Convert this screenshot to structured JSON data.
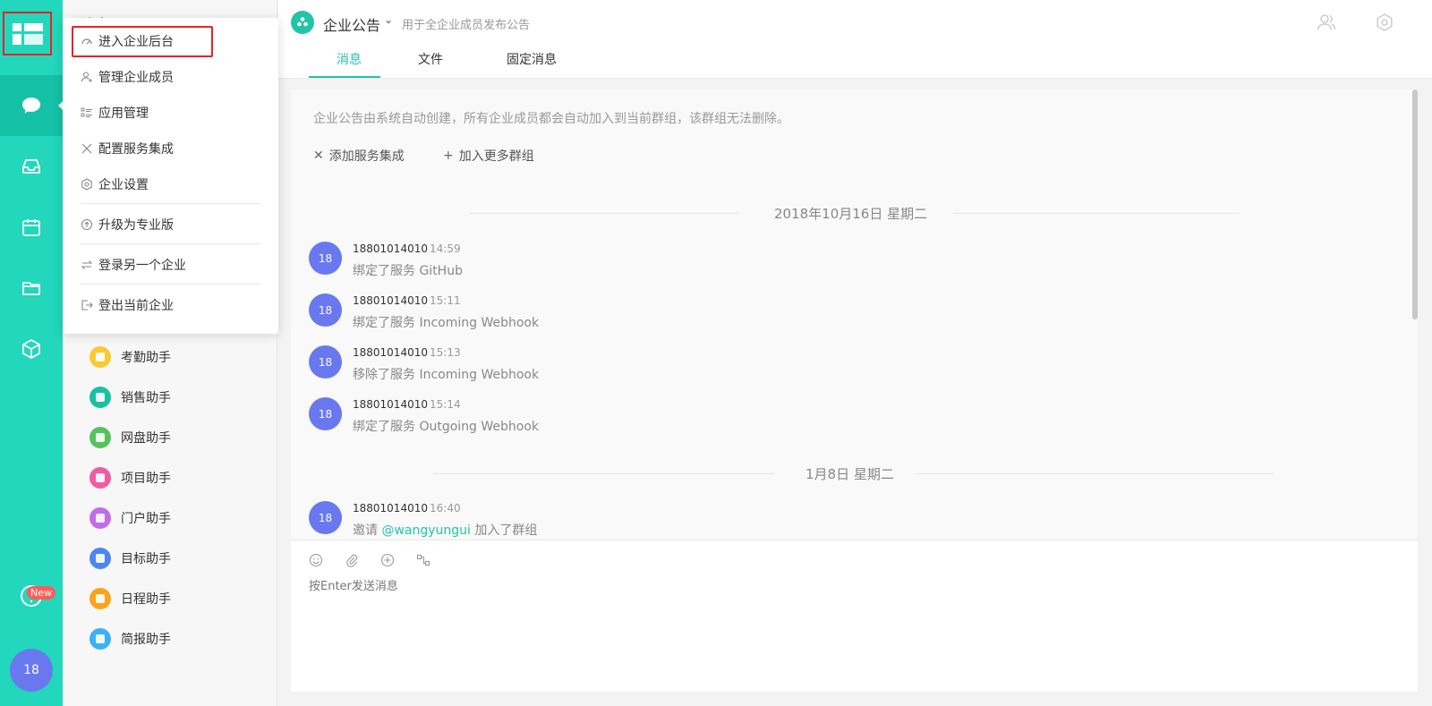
{
  "rail": {
    "avatar_text": "18",
    "new_badge": "New"
  },
  "sidebar": {
    "title": "消息",
    "assistants": [
      {
        "label": "考勤助手",
        "color": "#f9c932"
      },
      {
        "label": "销售助手",
        "color": "#19c1a0"
      },
      {
        "label": "网盘助手",
        "color": "#56c25d"
      },
      {
        "label": "项目助手",
        "color": "#f15ca1"
      },
      {
        "label": "门户助手",
        "color": "#c16ce8"
      },
      {
        "label": "目标助手",
        "color": "#4d86f0"
      },
      {
        "label": "日程助手",
        "color": "#f9a41c"
      },
      {
        "label": "简报助手",
        "color": "#3bb1f5"
      }
    ]
  },
  "menu": {
    "items": [
      {
        "label": "进入企业后台",
        "icon": "dashboard-icon"
      },
      {
        "label": "管理企业成员",
        "icon": "add-user-icon"
      },
      {
        "label": "应用管理",
        "icon": "app-list-icon"
      },
      {
        "label": "配置服务集成",
        "icon": "tools-icon"
      },
      {
        "label": "企业设置",
        "icon": "settings-icon"
      },
      {
        "label": "升级为专业版",
        "icon": "upgrade-icon"
      },
      {
        "label": "登录另一个企业",
        "icon": "switch-icon"
      },
      {
        "label": "登出当前企业",
        "icon": "logout-icon"
      }
    ]
  },
  "header": {
    "channel_name": "企业公告",
    "channel_desc": "用于全企业成员发布公告",
    "tabs": [
      "消息",
      "文件",
      "固定消息"
    ]
  },
  "main": {
    "notice": "企业公告由系统自动创建，所有企业成员都会自动加入到当前群组，该群组无法删除。",
    "actions": [
      "添加服务集成",
      "加入更多群组"
    ],
    "dates": [
      "2018年10月16日 星期二",
      "1月8日 星期二"
    ],
    "messages": [
      {
        "avatar": "18",
        "name": "18801014010",
        "time": "14:59",
        "text": "绑定了服务 GitHub"
      },
      {
        "avatar": "18",
        "name": "18801014010",
        "time": "15:11",
        "text": "绑定了服务 Incoming Webhook"
      },
      {
        "avatar": "18",
        "name": "18801014010",
        "time": "15:13",
        "text": "移除了服务 Incoming Webhook"
      },
      {
        "avatar": "18",
        "name": "18801014010",
        "time": "15:14",
        "text": "绑定了服务 Outgoing Webhook"
      },
      {
        "avatar": "18",
        "name": "18801014010",
        "time": "16:40",
        "text_prefix": "邀请 ",
        "mention": "@wangyungui",
        "text_suffix": " 加入了群组"
      }
    ]
  },
  "composer": {
    "placeholder": "按Enter发送消息"
  }
}
